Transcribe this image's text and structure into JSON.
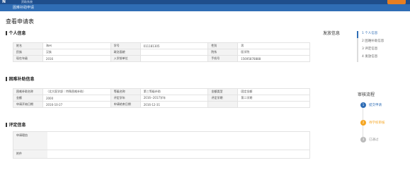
{
  "header": {
    "logo": "N",
    "logo_sub": "资助系统",
    "breadcrumb": "困难补助申请"
  },
  "page": {
    "title": "查看申请表"
  },
  "personal": {
    "section_title": "个人信息",
    "rows": [
      [
        {
          "k": "姓名",
          "v": "海州"
        },
        {
          "k": "学号",
          "v": "011181305"
        },
        {
          "k": "性别",
          "v": "男"
        }
      ],
      [
        {
          "k": "民族",
          "v": "汉族"
        },
        {
          "k": "政治面貌",
          "v": ""
        },
        {
          "k": "院系",
          "v": "医学院"
        }
      ],
      [
        {
          "k": "现在年级",
          "v": "2016"
        },
        {
          "k": "入学前单位",
          "v": ""
        },
        {
          "k": "手机号",
          "v": "15695878888"
        }
      ]
    ]
  },
  "subsidy": {
    "section_title": "困难补助信息",
    "rows": [
      [
        {
          "k": "困难补助名称",
          "v": "（北大医学部｜特殊困难补助）"
        },
        {
          "k": "等级名称",
          "v": "第三等级补助"
        },
        {
          "k": "金额类型",
          "v": "固定金额"
        }
      ],
      [
        {
          "k": "金额",
          "v": "2000"
        },
        {
          "k": "评定学年",
          "v": "2016--2017学年"
        },
        {
          "k": "评定学期",
          "v": "第二学期"
        }
      ],
      [
        {
          "k": "申请开始日期",
          "v": "2016-10-27"
        },
        {
          "k": "申请结束日期",
          "v": "2016-12-31"
        },
        {
          "k": "",
          "v": ""
        }
      ]
    ]
  },
  "evaluation": {
    "section_title": "评定信息",
    "reason_label": "申请理由",
    "attachment_label": "附件"
  },
  "side_nav": {
    "title": "发放信息",
    "items": [
      "个人信息",
      "困难补助信息",
      "评定信息",
      "发放信息"
    ]
  },
  "flow": {
    "title": "审核流程",
    "steps": [
      {
        "num": "1",
        "label": "提交申请",
        "color": "#2f6db5"
      },
      {
        "num": "2",
        "label": "待学校审核",
        "color": "#f5a623"
      },
      {
        "num": "3",
        "label": "已通过",
        "color": "#bbbbbb"
      }
    ]
  }
}
